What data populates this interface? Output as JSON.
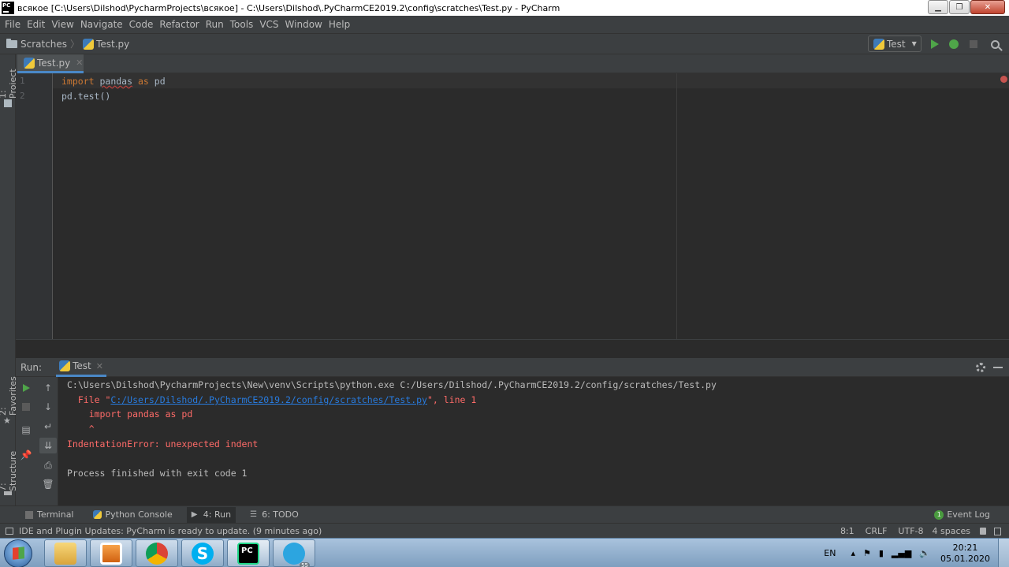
{
  "window": {
    "title": "всякое [C:\\Users\\Dilshod\\PycharmProjects\\всякое] - C:\\Users\\Dilshod\\.PyCharmCE2019.2\\config\\scratches\\Test.py - PyCharm",
    "app_icon_text": "PC"
  },
  "menu": [
    "File",
    "Edit",
    "View",
    "Navigate",
    "Code",
    "Refactor",
    "Run",
    "Tools",
    "VCS",
    "Window",
    "Help"
  ],
  "breadcrumb": [
    "Scratches",
    "Test.py"
  ],
  "run_config": {
    "label": "Test",
    "icon": "python-icon"
  },
  "toolbar_icons": [
    "run-icon",
    "debug-icon",
    "stop-icon",
    "search-icon"
  ],
  "left_tabs": {
    "project": "1: Project",
    "favorites": "2: Favorites",
    "structure": "7: Structure"
  },
  "editor": {
    "tab_label": "Test.py",
    "lines": [
      {
        "num": "1",
        "keyword1": "import",
        "module": "pandas",
        "keyword2": "as",
        "alias": "pd"
      },
      {
        "num": "2",
        "text": "pd.test()"
      }
    ]
  },
  "run_panel": {
    "label": "Run:",
    "tab": "Test",
    "console": {
      "cmd": "C:\\Users\\Dilshod\\PycharmProjects\\New\\venv\\Scripts\\python.exe C:/Users/Dilshod/.PyCharmCE2019.2/config/scratches/Test.py",
      "file_prefix": "  File \"",
      "file_link": "C:/Users/Dilshod/.PyCharmCE2019.2/config/scratches/Test.py",
      "file_suffix": "\", line 1",
      "code": "    import pandas as pd",
      "caret": "    ^",
      "error": "IndentationError: unexpected indent",
      "exit": "Process finished with exit code 1"
    }
  },
  "bottom_tabs": [
    {
      "label": "Terminal",
      "icon": "terminal-icon"
    },
    {
      "label": "Python Console",
      "icon": "python-console-icon"
    },
    {
      "label": "4: Run",
      "icon": "run-icon",
      "active": true
    },
    {
      "label": "6: TODO",
      "icon": "todo-icon"
    }
  ],
  "event_log": {
    "label": "Event Log",
    "count": "1"
  },
  "status": {
    "message": "IDE and Plugin Updates: PyCharm is ready to update. (9 minutes ago)",
    "position": "8:1",
    "line_sep": "CRLF",
    "encoding": "UTF-8",
    "indent": "4 spaces"
  },
  "taskbar": {
    "apps": [
      "explorer",
      "media-player",
      "chrome",
      "skype",
      "pycharm",
      "telegram"
    ],
    "telegram_badge": "55",
    "lang": "EN",
    "time": "20:21",
    "date": "05.01.2020"
  },
  "colors": {
    "accent": "#4a88c7",
    "error": "#ff6b68",
    "keyword": "#cc7832",
    "link": "#287bde"
  }
}
